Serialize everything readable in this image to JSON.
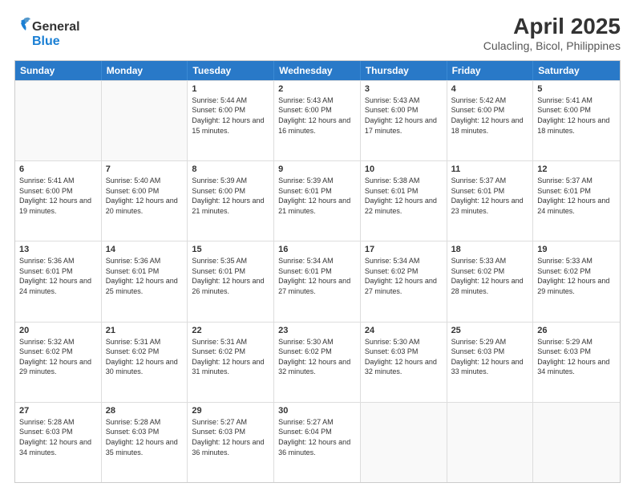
{
  "header": {
    "logo_general": "General",
    "logo_blue": "Blue",
    "title": "April 2025",
    "subtitle": "Culacling, Bicol, Philippines"
  },
  "calendar": {
    "days": [
      "Sunday",
      "Monday",
      "Tuesday",
      "Wednesday",
      "Thursday",
      "Friday",
      "Saturday"
    ],
    "weeks": [
      [
        {
          "day": "",
          "info": ""
        },
        {
          "day": "",
          "info": ""
        },
        {
          "day": "1",
          "info": "Sunrise: 5:44 AM\nSunset: 6:00 PM\nDaylight: 12 hours and 15 minutes."
        },
        {
          "day": "2",
          "info": "Sunrise: 5:43 AM\nSunset: 6:00 PM\nDaylight: 12 hours and 16 minutes."
        },
        {
          "day": "3",
          "info": "Sunrise: 5:43 AM\nSunset: 6:00 PM\nDaylight: 12 hours and 17 minutes."
        },
        {
          "day": "4",
          "info": "Sunrise: 5:42 AM\nSunset: 6:00 PM\nDaylight: 12 hours and 18 minutes."
        },
        {
          "day": "5",
          "info": "Sunrise: 5:41 AM\nSunset: 6:00 PM\nDaylight: 12 hours and 18 minutes."
        }
      ],
      [
        {
          "day": "6",
          "info": "Sunrise: 5:41 AM\nSunset: 6:00 PM\nDaylight: 12 hours and 19 minutes."
        },
        {
          "day": "7",
          "info": "Sunrise: 5:40 AM\nSunset: 6:00 PM\nDaylight: 12 hours and 20 minutes."
        },
        {
          "day": "8",
          "info": "Sunrise: 5:39 AM\nSunset: 6:00 PM\nDaylight: 12 hours and 21 minutes."
        },
        {
          "day": "9",
          "info": "Sunrise: 5:39 AM\nSunset: 6:01 PM\nDaylight: 12 hours and 21 minutes."
        },
        {
          "day": "10",
          "info": "Sunrise: 5:38 AM\nSunset: 6:01 PM\nDaylight: 12 hours and 22 minutes."
        },
        {
          "day": "11",
          "info": "Sunrise: 5:37 AM\nSunset: 6:01 PM\nDaylight: 12 hours and 23 minutes."
        },
        {
          "day": "12",
          "info": "Sunrise: 5:37 AM\nSunset: 6:01 PM\nDaylight: 12 hours and 24 minutes."
        }
      ],
      [
        {
          "day": "13",
          "info": "Sunrise: 5:36 AM\nSunset: 6:01 PM\nDaylight: 12 hours and 24 minutes."
        },
        {
          "day": "14",
          "info": "Sunrise: 5:36 AM\nSunset: 6:01 PM\nDaylight: 12 hours and 25 minutes."
        },
        {
          "day": "15",
          "info": "Sunrise: 5:35 AM\nSunset: 6:01 PM\nDaylight: 12 hours and 26 minutes."
        },
        {
          "day": "16",
          "info": "Sunrise: 5:34 AM\nSunset: 6:01 PM\nDaylight: 12 hours and 27 minutes."
        },
        {
          "day": "17",
          "info": "Sunrise: 5:34 AM\nSunset: 6:02 PM\nDaylight: 12 hours and 27 minutes."
        },
        {
          "day": "18",
          "info": "Sunrise: 5:33 AM\nSunset: 6:02 PM\nDaylight: 12 hours and 28 minutes."
        },
        {
          "day": "19",
          "info": "Sunrise: 5:33 AM\nSunset: 6:02 PM\nDaylight: 12 hours and 29 minutes."
        }
      ],
      [
        {
          "day": "20",
          "info": "Sunrise: 5:32 AM\nSunset: 6:02 PM\nDaylight: 12 hours and 29 minutes."
        },
        {
          "day": "21",
          "info": "Sunrise: 5:31 AM\nSunset: 6:02 PM\nDaylight: 12 hours and 30 minutes."
        },
        {
          "day": "22",
          "info": "Sunrise: 5:31 AM\nSunset: 6:02 PM\nDaylight: 12 hours and 31 minutes."
        },
        {
          "day": "23",
          "info": "Sunrise: 5:30 AM\nSunset: 6:02 PM\nDaylight: 12 hours and 32 minutes."
        },
        {
          "day": "24",
          "info": "Sunrise: 5:30 AM\nSunset: 6:03 PM\nDaylight: 12 hours and 32 minutes."
        },
        {
          "day": "25",
          "info": "Sunrise: 5:29 AM\nSunset: 6:03 PM\nDaylight: 12 hours and 33 minutes."
        },
        {
          "day": "26",
          "info": "Sunrise: 5:29 AM\nSunset: 6:03 PM\nDaylight: 12 hours and 34 minutes."
        }
      ],
      [
        {
          "day": "27",
          "info": "Sunrise: 5:28 AM\nSunset: 6:03 PM\nDaylight: 12 hours and 34 minutes."
        },
        {
          "day": "28",
          "info": "Sunrise: 5:28 AM\nSunset: 6:03 PM\nDaylight: 12 hours and 35 minutes."
        },
        {
          "day": "29",
          "info": "Sunrise: 5:27 AM\nSunset: 6:03 PM\nDaylight: 12 hours and 36 minutes."
        },
        {
          "day": "30",
          "info": "Sunrise: 5:27 AM\nSunset: 6:04 PM\nDaylight: 12 hours and 36 minutes."
        },
        {
          "day": "",
          "info": ""
        },
        {
          "day": "",
          "info": ""
        },
        {
          "day": "",
          "info": ""
        }
      ]
    ]
  }
}
